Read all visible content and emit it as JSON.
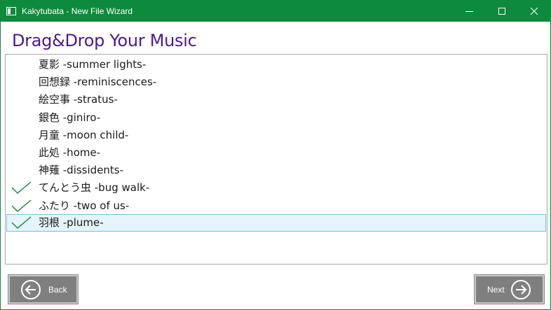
{
  "window": {
    "title": "Kakytubata - New File Wizard",
    "accent_color": "#0e8a3c"
  },
  "page": {
    "heading": "Drag&Drop Your Music",
    "heading_color": "#4b1a8a"
  },
  "tracks": [
    {
      "title": "夏影 -summer lights-",
      "checked": false
    },
    {
      "title": "回想録 -reminiscences-",
      "checked": false
    },
    {
      "title": "絵空事 -stratus-",
      "checked": false
    },
    {
      "title": "銀色 -giniro-",
      "checked": false
    },
    {
      "title": "月童 -moon child-",
      "checked": false
    },
    {
      "title": "此処 -home-",
      "checked": false
    },
    {
      "title": "神薙 -dissidents-",
      "checked": false
    },
    {
      "title": "てんとう虫 -bug walk-",
      "checked": true
    },
    {
      "title": "ふたり -two of us-",
      "checked": true
    },
    {
      "title": "羽根 -plume-",
      "checked": true,
      "selected": true
    }
  ],
  "buttons": {
    "back_label": "Back",
    "next_label": "Next"
  }
}
